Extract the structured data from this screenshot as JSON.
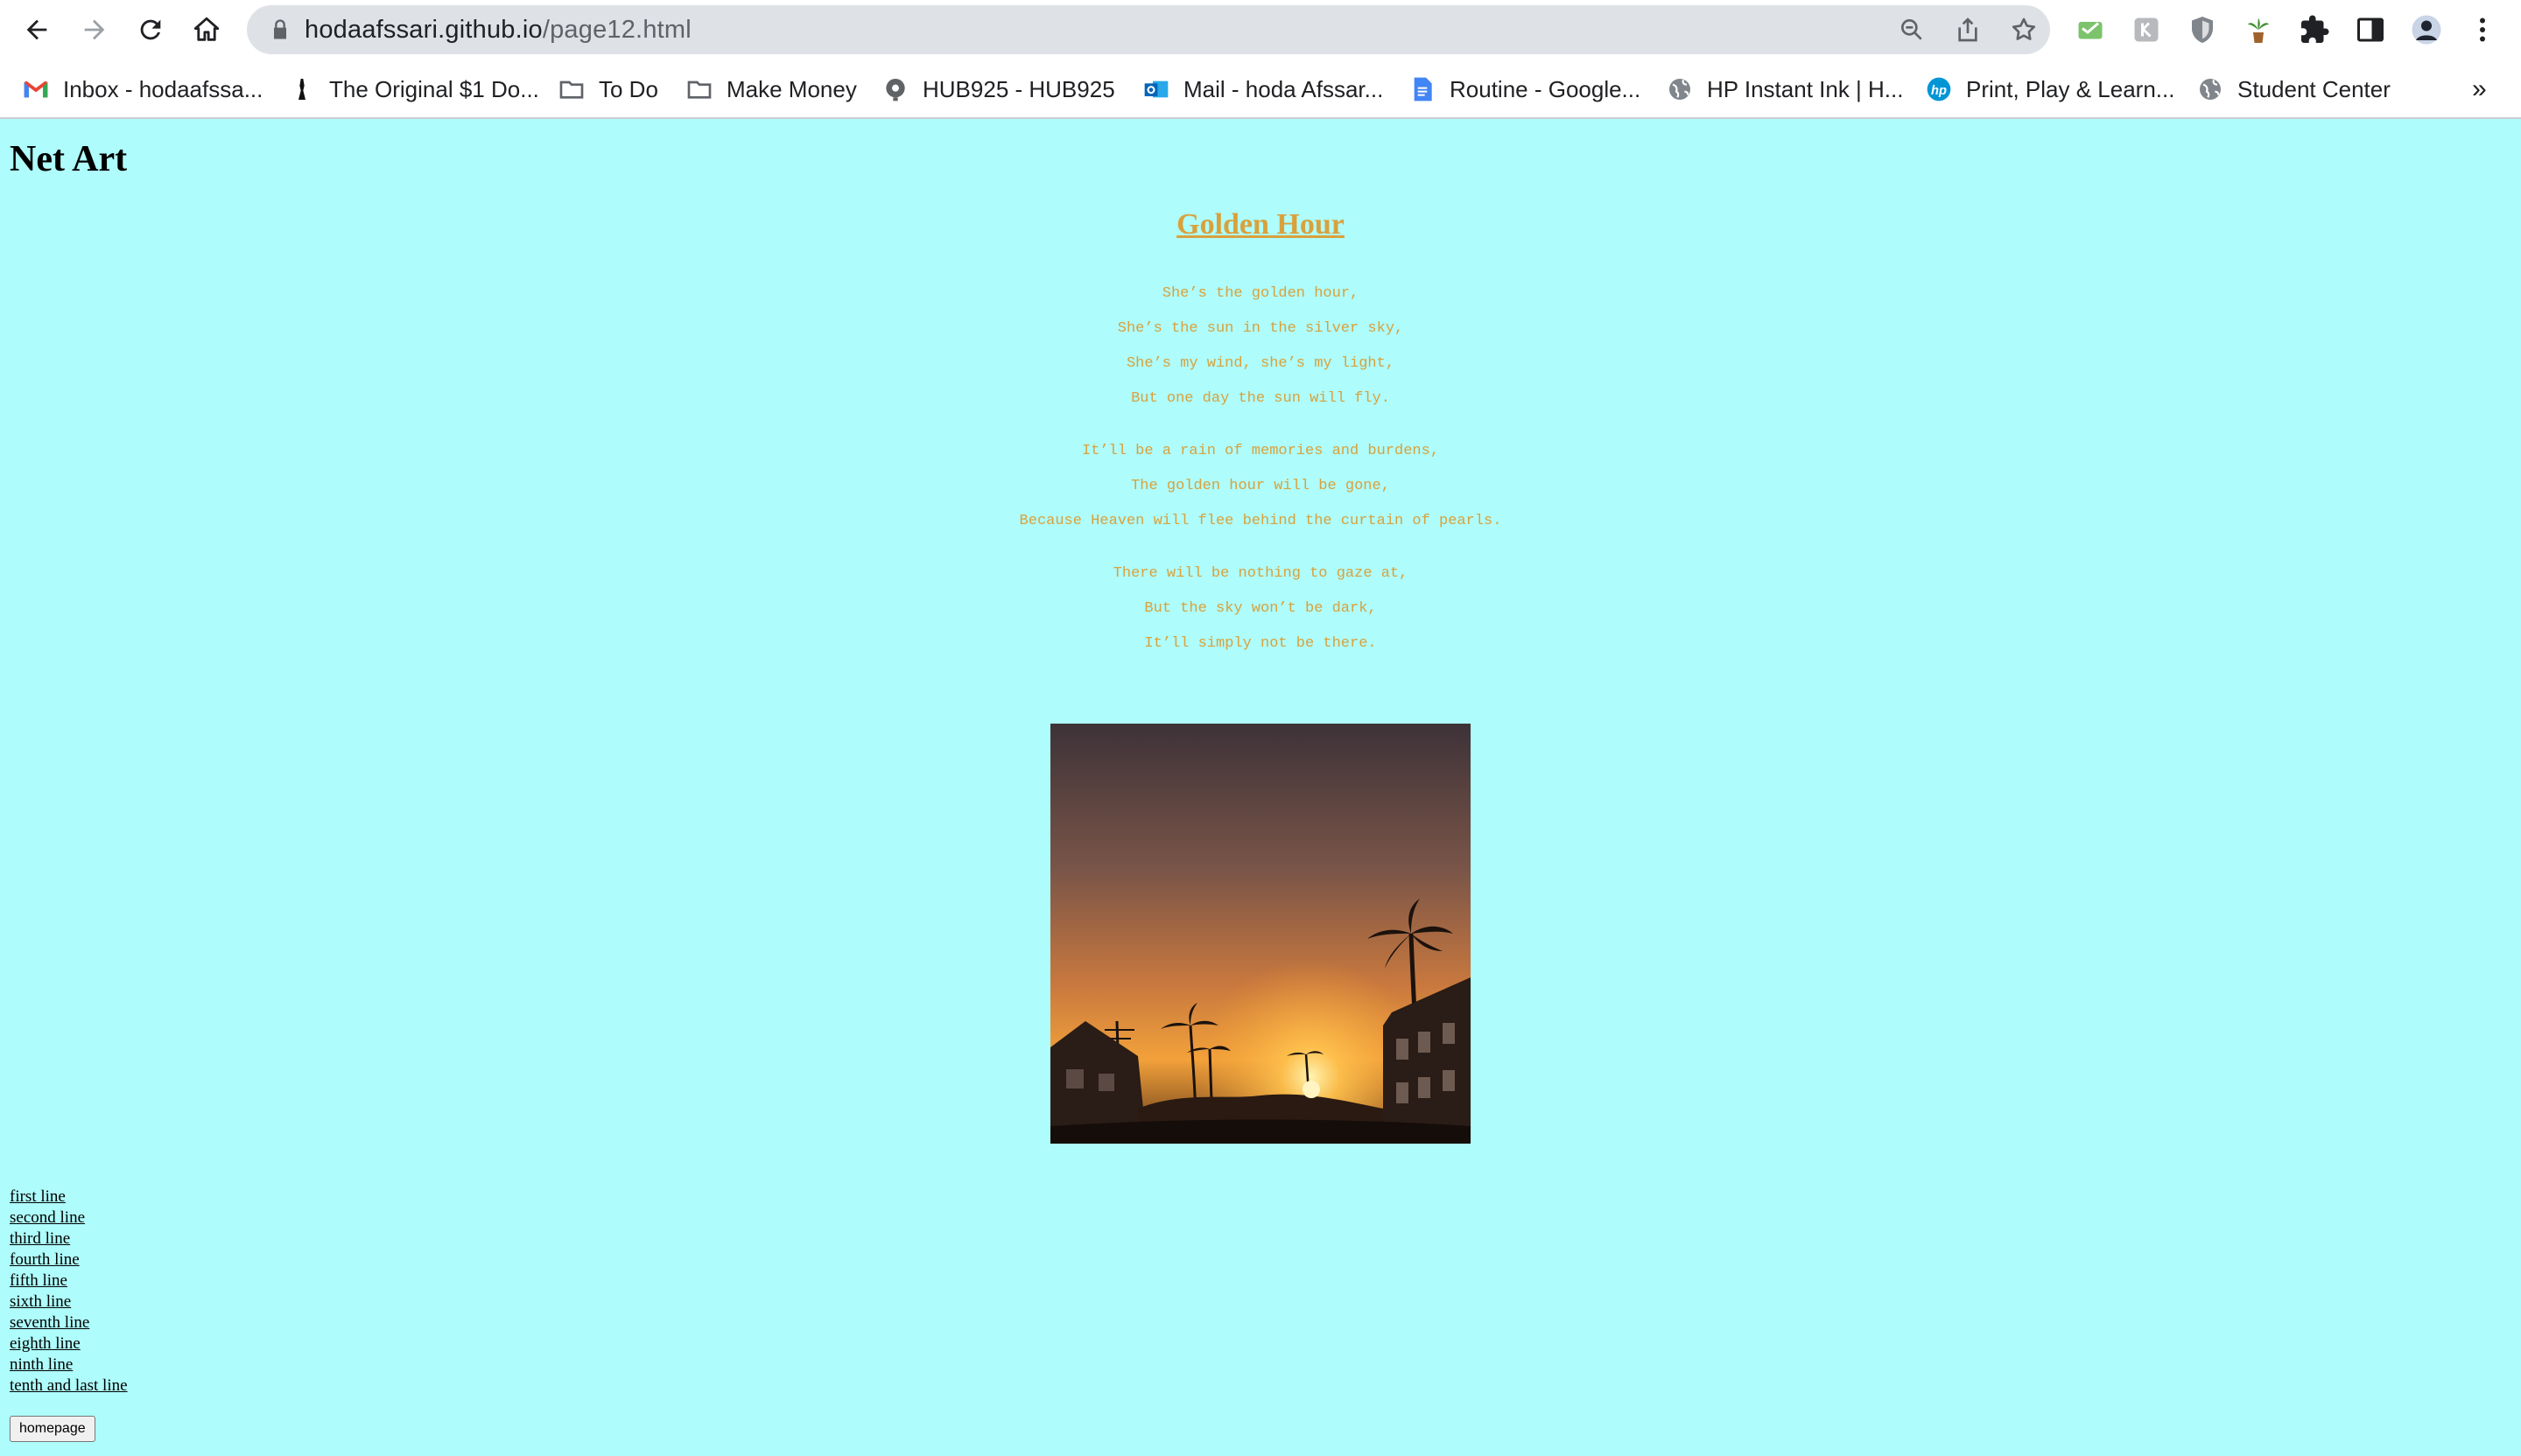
{
  "browser": {
    "url_host": "hodaafssari.github.io",
    "url_path": "/page12.html",
    "bookmarks": [
      {
        "label": "Inbox - hodaafssa...",
        "icon": "gmail-icon"
      },
      {
        "label": "The Original $1 Do...",
        "icon": "bowling-pin-icon"
      },
      {
        "label": "To Do",
        "icon": "folder-icon"
      },
      {
        "label": "Make Money",
        "icon": "folder-icon"
      },
      {
        "label": "HUB925 - HUB925",
        "icon": "hub-globe-icon"
      },
      {
        "label": "Mail - hoda Afssar...",
        "icon": "outlook-icon"
      },
      {
        "label": "Routine - Google...",
        "icon": "google-docs-icon"
      },
      {
        "label": "HP Instant Ink | H...",
        "icon": "globe-icon"
      },
      {
        "label": "Print, Play & Learn...",
        "icon": "hp-icon"
      },
      {
        "label": "Student Center",
        "icon": "globe-icon"
      }
    ],
    "overflow_label": "»"
  },
  "page": {
    "site_title": "Net Art",
    "poem_title": "Golden Hour",
    "stanzas": [
      [
        "She’s the golden hour,",
        "She’s the sun in the silver sky,",
        "She’s my wind, she’s my light,",
        "But one day the sun will fly."
      ],
      [
        "It’ll be a rain of memories and burdens,",
        "The golden hour will be gone,",
        "Because Heaven will flee behind the curtain of pearls."
      ],
      [
        "There will be nothing to gaze at,",
        "But the sky won’t be dark,",
        "It’ll simply not be there."
      ]
    ],
    "links": [
      "first line",
      "second line",
      "third line",
      "fourth line",
      "fifth line",
      "sixth line",
      "seventh line",
      "eighth line",
      "ninth line",
      "tenth and last line"
    ],
    "home_button": "homepage"
  },
  "colors": {
    "page_background": "#aefcfb",
    "poem_text": "#d9a13c"
  }
}
